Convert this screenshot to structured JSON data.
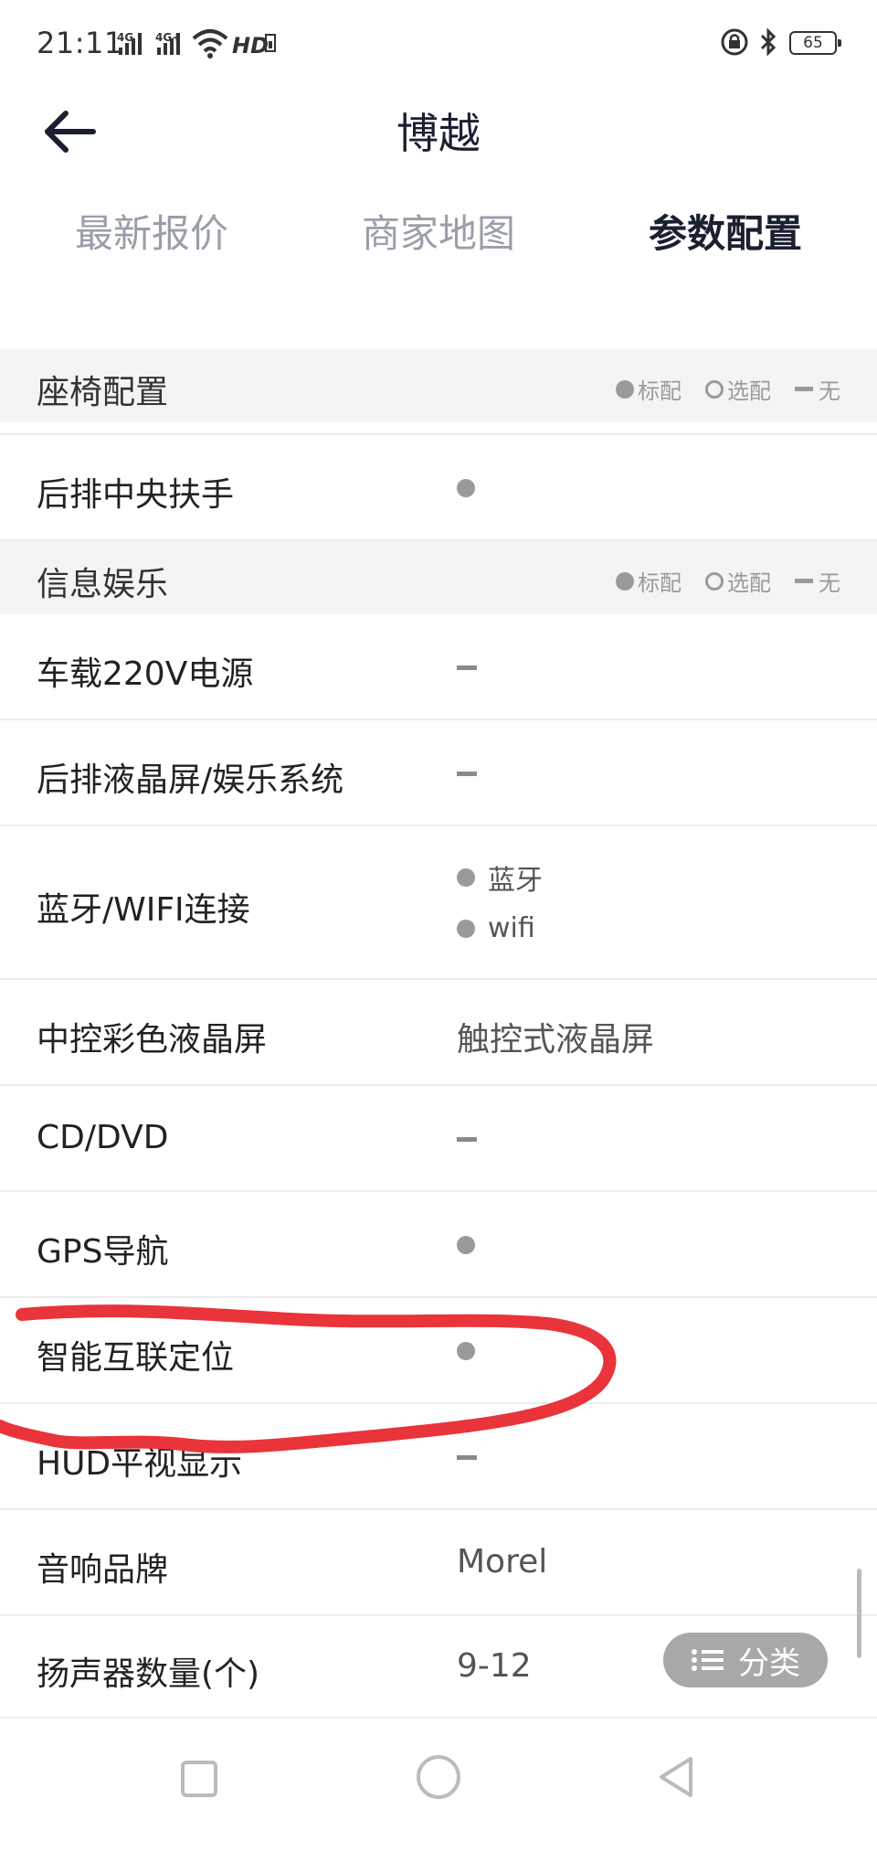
{
  "status": {
    "time": "21:11",
    "network_1": "4G",
    "network_2": "4G+",
    "hd": "HD",
    "battery": "65"
  },
  "header": {
    "title": "博越"
  },
  "tabs": [
    {
      "label": "最新报价",
      "active": false
    },
    {
      "label": "商家地图",
      "active": false
    },
    {
      "label": "参数配置",
      "active": true
    }
  ],
  "legend": {
    "standard": "标配",
    "optional": "选配",
    "none": "无"
  },
  "sections": {
    "seat": {
      "title": "座椅配置",
      "rows": [
        {
          "label": "后排中央扶手",
          "value_type": "standard"
        }
      ]
    },
    "info": {
      "title": "信息娱乐",
      "rows": [
        {
          "label": "车载220V电源",
          "value_type": "none"
        },
        {
          "label": "后排液晶屏/娱乐系统",
          "value_type": "none"
        },
        {
          "label": "蓝牙/WIFI连接",
          "value_type": "list",
          "items": [
            "蓝牙",
            "wifi"
          ]
        },
        {
          "label": "中控彩色液晶屏",
          "value_type": "text",
          "value": "触控式液晶屏"
        },
        {
          "label": "CD/DVD",
          "value_type": "none"
        },
        {
          "label": "GPS导航",
          "value_type": "standard"
        },
        {
          "label": "智能互联定位",
          "value_type": "standard"
        },
        {
          "label": "HUD平视显示",
          "value_type": "none"
        },
        {
          "label": "音响品牌",
          "value_type": "text",
          "value": "Morel"
        },
        {
          "label": "扬声器数量(个)",
          "value_type": "text",
          "value": "9-12"
        }
      ]
    }
  },
  "category_button": {
    "label": "分类"
  },
  "colors": {
    "title": "#1b2030",
    "tab_inactive": "#9a9ea8",
    "section_bg": "#f4f4f4",
    "marker_gray": "#9a9a9a",
    "annotation_red": "#e8343a"
  }
}
